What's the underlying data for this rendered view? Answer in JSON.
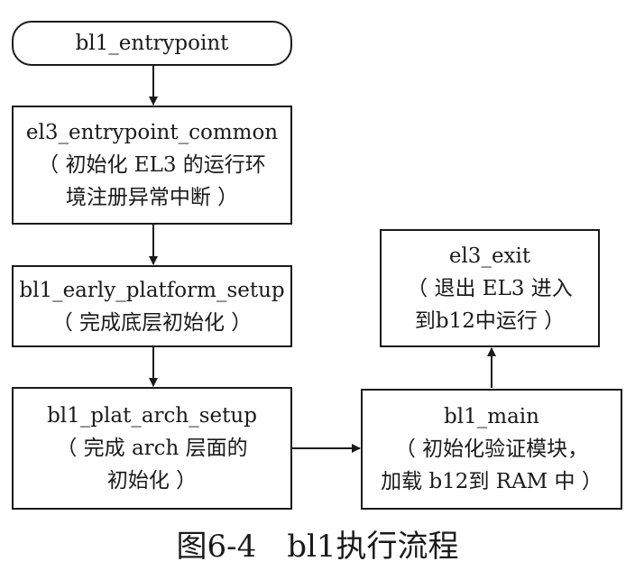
{
  "nodes": {
    "entry": {
      "lines": [
        "bl1_entrypoint"
      ]
    },
    "common": {
      "lines": [
        "el3_entrypoint_common",
        "（ 初始化 EL3 的运行环",
        "境注册异常中断 ）"
      ]
    },
    "early": {
      "lines": [
        "bl1_early_platform_setup",
        "（ 完成底层初始化 ）"
      ]
    },
    "arch": {
      "lines": [
        "bl1_plat_arch_setup",
        "（ 完成 arch 层面的",
        "初始化 ）"
      ]
    },
    "main": {
      "lines": [
        "bl1_main",
        "（ 初始化验证模块，",
        "加载 b12到 RAM 中 ）"
      ]
    },
    "exit": {
      "lines": [
        "el3_exit",
        "（ 退出 EL3 进入",
        "到b12中运行 ）"
      ]
    }
  },
  "caption": "图6-4　bl1执行流程"
}
